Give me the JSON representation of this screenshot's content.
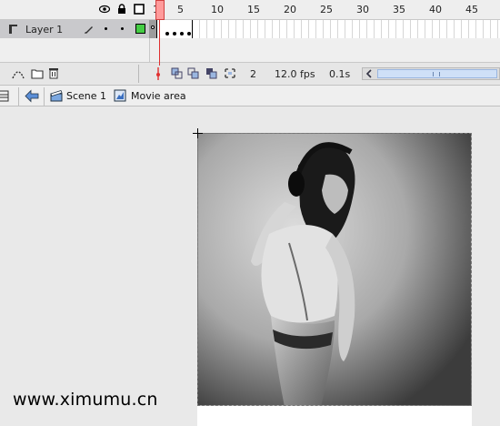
{
  "timeline": {
    "frame_numbers": [
      "1",
      "5",
      "10",
      "15",
      "20",
      "25",
      "30",
      "35",
      "40",
      "45"
    ],
    "layer": {
      "name": "Layer 1",
      "outline_color": "#44cc44"
    },
    "footer": {
      "current_frame": "2",
      "frame_rate": "12.0 fps",
      "elapsed_time": "0.1s"
    }
  },
  "edit_bar": {
    "scene_label": "Scene 1",
    "symbol_label": "Movie area"
  },
  "stage": {
    "watermark": "www.ximumu.cn"
  },
  "colors": {
    "playhead": "#e03030",
    "scroll_thumb": "#cfe0f7",
    "layer_highlight": "#c9c9cc"
  }
}
